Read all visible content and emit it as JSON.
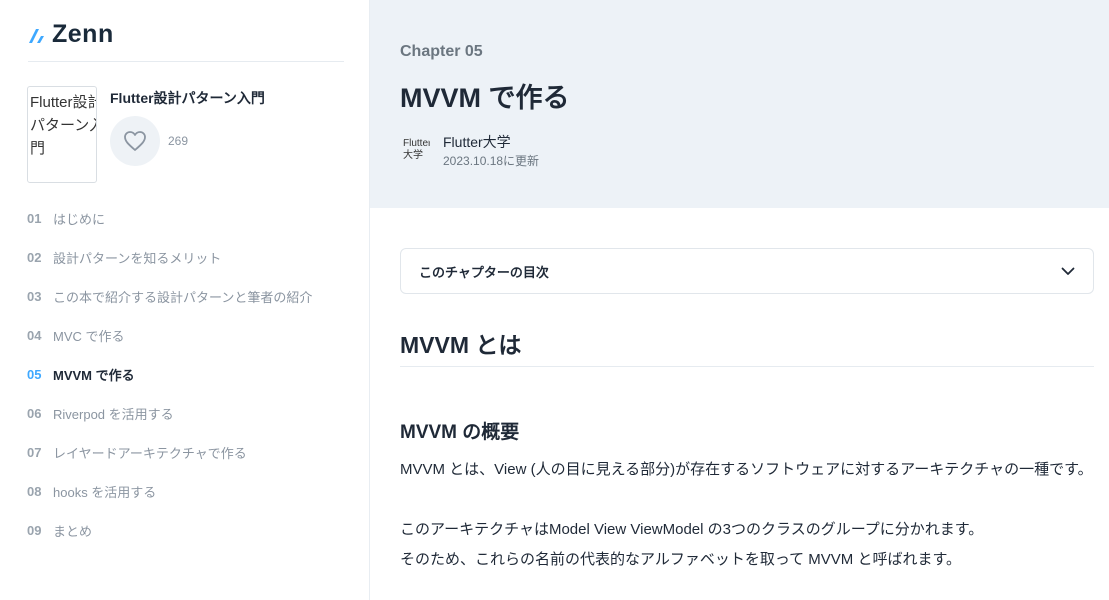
{
  "brand": {
    "name": "Zenn",
    "color": "#3ea8ff"
  },
  "book": {
    "title": "Flutter設計パターン入門",
    "cover_alt": "Flutter設計パターン入門",
    "likes": "269"
  },
  "toc": [
    {
      "num": "01",
      "label": "はじめに",
      "active": false
    },
    {
      "num": "02",
      "label": "設計パターンを知るメリット",
      "active": false
    },
    {
      "num": "03",
      "label": "この本で紹介する設計パターンと筆者の紹介",
      "active": false
    },
    {
      "num": "04",
      "label": "MVC で作る",
      "active": false
    },
    {
      "num": "05",
      "label": "MVVM で作る",
      "active": true
    },
    {
      "num": "06",
      "label": "Riverpod を活用する",
      "active": false
    },
    {
      "num": "07",
      "label": "レイヤードアーキテクチャで作る",
      "active": false
    },
    {
      "num": "08",
      "label": "hooks を活用する",
      "active": false
    },
    {
      "num": "09",
      "label": "まとめ",
      "active": false
    }
  ],
  "chapter": {
    "label": "Chapter 05",
    "title": "MVVM で作る",
    "author": "Flutter大学",
    "author_avatar_alt": "Flutter大学",
    "updated": "2023.10.18に更新"
  },
  "chapter_toc": {
    "label": "このチャプターの目次"
  },
  "content": {
    "h2": "MVVM とは",
    "h3": "MVVM の概要",
    "p1": "MVVM とは、View (人の目に見える部分)が存在するソフトウェアに対するアーキテクチャの一種です。",
    "p2": "このアーキテクチャはModel View ViewModel の3つのクラスのグループに分かれます。",
    "p3": "そのため、これらの名前の代表的なアルファベットを取って MVVM と呼ばれます。"
  }
}
